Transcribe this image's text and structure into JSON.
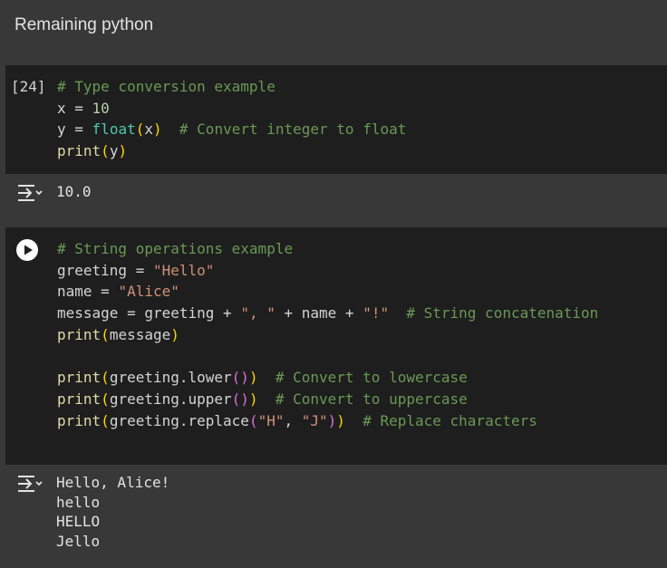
{
  "section": {
    "title": "Remaining python"
  },
  "cells": [
    {
      "execution_count": "[24]",
      "code": {
        "l1_comment": "# Type conversion example",
        "l2_var": "x",
        "l2_eq": " = ",
        "l2_num": "10",
        "l3_var": "y",
        "l3_eq": " = ",
        "l3_fn": "float",
        "l3_open": "(",
        "l3_arg": "x",
        "l3_close": ")",
        "l3_gap": "  ",
        "l3_comment": "# Convert integer to float",
        "l4_fn": "print",
        "l4_open": "(",
        "l4_arg": "y",
        "l4_close": ")"
      },
      "output": [
        "10.0"
      ]
    },
    {
      "run_button_icon": "play-icon",
      "code": {
        "l1_comment": "# String operations example",
        "l2_var": "greeting",
        "l2_eq": " = ",
        "l2_str": "\"Hello\"",
        "l3_var": "name",
        "l3_eq": " = ",
        "l3_str": "\"Alice\"",
        "l4_var": "message",
        "l4_eq": " = ",
        "l4_a": "greeting",
        "l4_plus1": " + ",
        "l4_str1": "\", \"",
        "l4_plus2": " + ",
        "l4_b": "name",
        "l4_plus3": " + ",
        "l4_str2": "\"!\"",
        "l4_gap": "  ",
        "l4_comment": "# String concatenation",
        "l5_fn": "print",
        "l5_open": "(",
        "l5_arg": "message",
        "l5_close": ")",
        "l7_fn": "print",
        "l7_open": "(",
        "l7_obj": "greeting.lower",
        "l7_inner": "()",
        "l7_close": ")",
        "l7_gap": "  ",
        "l7_comment": "# Convert to lowercase",
        "l8_fn": "print",
        "l8_open": "(",
        "l8_obj": "greeting.upper",
        "l8_inner": "()",
        "l8_close": ")",
        "l8_gap": "  ",
        "l8_comment": "# Convert to uppercase",
        "l9_fn": "print",
        "l9_open": "(",
        "l9_obj": "greeting.replace",
        "l9_iopen": "(",
        "l9_s1": "\"H\"",
        "l9_comma": ", ",
        "l9_s2": "\"J\"",
        "l9_iclose": ")",
        "l9_close": ")",
        "l9_gap": "  ",
        "l9_comment": "# Replace characters"
      },
      "output": [
        "Hello, Alice!",
        "hello",
        "HELLO",
        "Jello"
      ]
    }
  ],
  "icons": {
    "output_toggle": "output-toggle-icon",
    "run": "play-icon"
  },
  "colors": {
    "page_background": "#383838",
    "cell_background": "#1e1e1e",
    "comment": "#6a9955",
    "number": "#b5cea8",
    "string": "#ce9178",
    "function": "#dcdcaa",
    "builtin": "#4ec9b0",
    "bracket_level1": "#ffd700",
    "bracket_level2": "#da70d6"
  }
}
